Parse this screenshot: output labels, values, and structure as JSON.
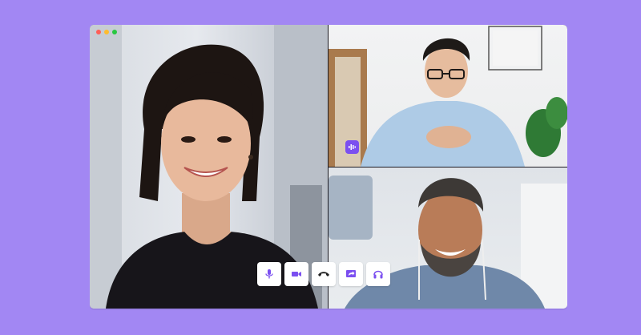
{
  "colors": {
    "background": "#a287f3",
    "accent": "#7b4ff0",
    "window_frame": "#1c1a22",
    "traffic_red": "#ff5f57",
    "traffic_yellow": "#febc2e",
    "traffic_green": "#28c840"
  },
  "window": {
    "controls": [
      "close-dot",
      "minimize-dot",
      "maximize-dot"
    ]
  },
  "participants": [
    {
      "tile": "main",
      "description_icon": "participant-video-woman"
    },
    {
      "tile": "top-right",
      "description_icon": "participant-video-man-glasses",
      "speaking": true
    },
    {
      "tile": "bottom-right",
      "description_icon": "participant-video-man-beard"
    }
  ],
  "toolbar": {
    "buttons": [
      {
        "icon": "microphone-icon"
      },
      {
        "icon": "camera-icon"
      },
      {
        "icon": "hang-up-icon"
      },
      {
        "icon": "share-screen-icon"
      },
      {
        "icon": "headphones-icon"
      }
    ]
  }
}
